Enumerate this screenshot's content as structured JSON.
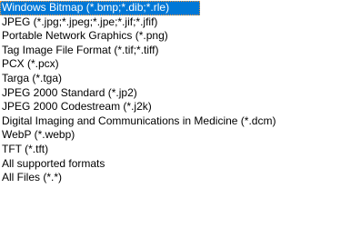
{
  "file_type_list": {
    "selected_index": 0,
    "colors": {
      "selection_bg": "#0078d7",
      "selection_text": "#ffffff"
    },
    "items": [
      {
        "label": "Windows Bitmap (*.bmp;*.dib;*.rle)"
      },
      {
        "label": "JPEG (*.jpg;*.jpeg;*.jpe;*.jif;*.jfif)"
      },
      {
        "label": "Portable Network Graphics (*.png)"
      },
      {
        "label": "Tag Image File Format (*.tif;*.tiff)"
      },
      {
        "label": "PCX (*.pcx)"
      },
      {
        "label": "Targa (*.tga)"
      },
      {
        "label": "JPEG 2000 Standard (*.jp2)"
      },
      {
        "label": "JPEG 2000 Codestream (*.j2k)"
      },
      {
        "label": "Digital Imaging and Communications in Medicine (*.dcm)"
      },
      {
        "label": "WebP (*.webp)"
      },
      {
        "label": "TFT (*.tft)"
      },
      {
        "label": "All supported formats"
      },
      {
        "label": "All Files (*.*)"
      }
    ]
  }
}
